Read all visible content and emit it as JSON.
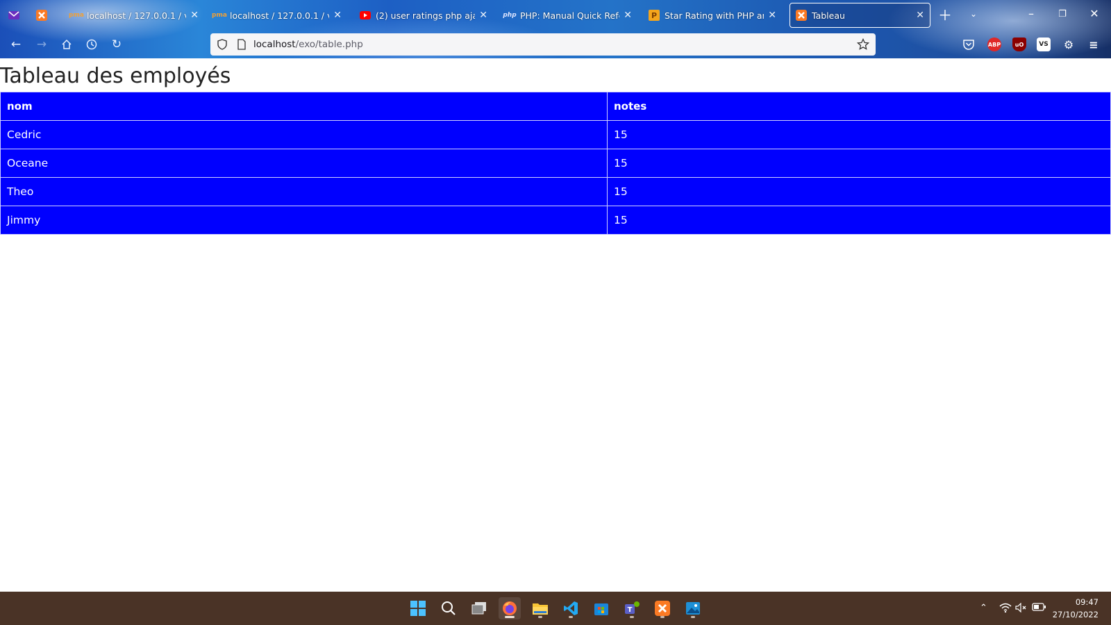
{
  "browser": {
    "tabs": [
      {
        "title": "localhost / 127.0.0.1 / vroom",
        "favicon": "phpmyadmin-icon"
      },
      {
        "title": "localhost / 127.0.0.1 / vroom",
        "favicon": "phpmyadmin-icon"
      },
      {
        "title": "(2) user ratings php ajax - Yo",
        "favicon": "youtube-icon"
      },
      {
        "title": "PHP: Manual Quick Referen",
        "favicon": "php-icon"
      },
      {
        "title": "Star Rating with PHP and jQ",
        "favicon": "p-icon"
      },
      {
        "title": "Tableau",
        "favicon": "xampp-icon",
        "active": true
      }
    ],
    "url_host": "localhost",
    "url_path": "/exo/table.php",
    "extensions": [
      "pocket-icon",
      "adblock-icon",
      "ublock-icon",
      "vscode-icon",
      "settings-icon"
    ],
    "colors": {
      "accent": "#0000ff",
      "taskbar": "#4a3326"
    }
  },
  "page": {
    "title": "Tableau des employés",
    "table": {
      "headers": [
        "nom",
        "notes"
      ],
      "rows": [
        [
          "Cedric",
          "15"
        ],
        [
          "Oceane",
          "15"
        ],
        [
          "Theo",
          "15"
        ],
        [
          "Jimmy",
          "15"
        ]
      ]
    }
  },
  "taskbar": {
    "apps": [
      "windows-start-icon",
      "search-icon",
      "task-view-icon",
      "firefox-icon",
      "file-explorer-icon",
      "vscode-icon",
      "store-icon",
      "teams-icon",
      "xampp-icon",
      "photos-icon"
    ],
    "time": "09:47",
    "date": "27/10/2022"
  }
}
